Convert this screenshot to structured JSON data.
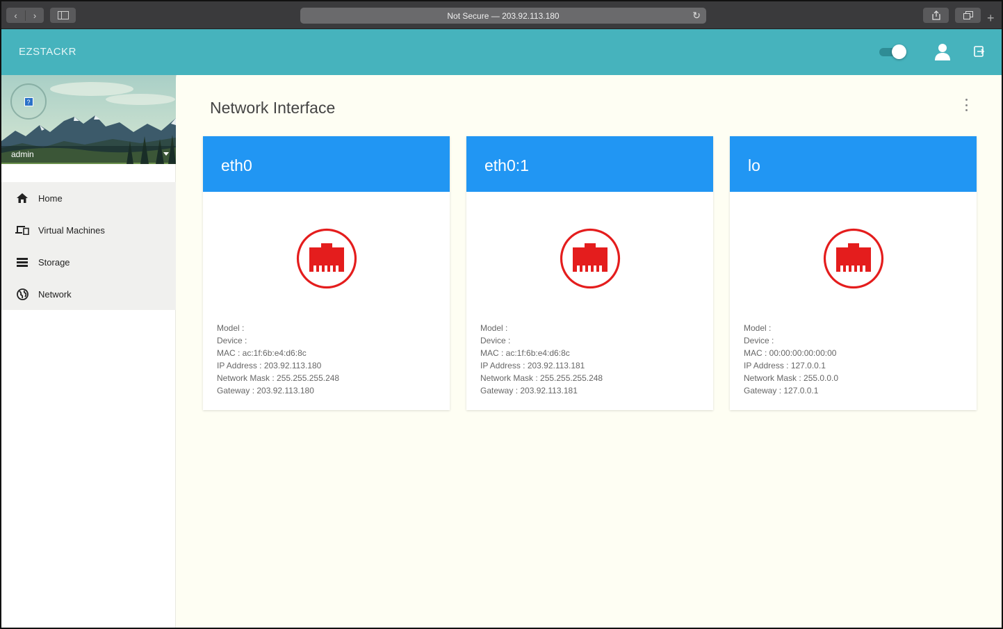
{
  "browser": {
    "url_text": "Not Secure — 203.92.113.180",
    "nav_back_icon": "chevron-left-icon",
    "nav_forward_icon": "chevron-right-icon"
  },
  "app": {
    "brand": "EZSTACKR",
    "accent_color": "#46b3bd",
    "card_header_color": "#2196f3",
    "icon_color": "#e41d1d"
  },
  "sidebar": {
    "username": "admin",
    "items": [
      {
        "label": "Home",
        "icon": "home-icon"
      },
      {
        "label": "Virtual Machines",
        "icon": "devices-icon"
      },
      {
        "label": "Storage",
        "icon": "storage-icon"
      },
      {
        "label": "Network",
        "icon": "globe-icon"
      }
    ]
  },
  "main": {
    "title": "Network Interface",
    "interfaces": [
      {
        "name": "eth0",
        "model": "Model :",
        "device": "Device :",
        "mac": "MAC : ac:1f:6b:e4:d6:8c",
        "ip": "IP Address : 203.92.113.180",
        "mask": "Network Mask : 255.255.255.248",
        "gateway": "Gateway : 203.92.113.180"
      },
      {
        "name": "eth0:1",
        "model": "Model :",
        "device": "Device :",
        "mac": "MAC : ac:1f:6b:e4:d6:8c",
        "ip": "IP Address : 203.92.113.181",
        "mask": "Network Mask : 255.255.255.248",
        "gateway": "Gateway : 203.92.113.181"
      },
      {
        "name": "lo",
        "model": "Model :",
        "device": "Device :",
        "mac": "MAC : 00:00:00:00:00:00",
        "ip": "IP Address : 127.0.0.1",
        "mask": "Network Mask : 255.0.0.0",
        "gateway": "Gateway : 127.0.0.1"
      }
    ]
  }
}
